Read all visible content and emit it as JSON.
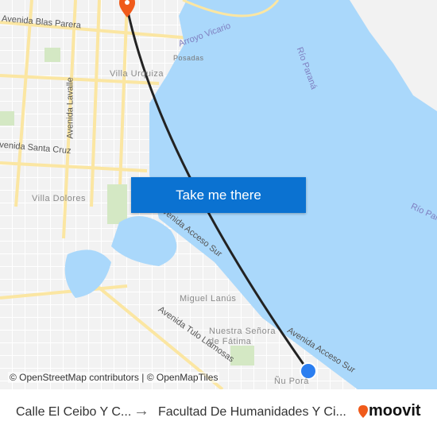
{
  "map": {
    "places": [
      "Villa Urquiza",
      "Posadas",
      "Villa Dolores",
      "Miguel Lanús",
      "Nuestra Señora de Fátima",
      "Ñu Porá"
    ],
    "roads": [
      "Avenida Blas Parera",
      "Avenida Lavalle",
      "Avenida Santa Cruz",
      "Avenida Acceso Sur",
      "Avenida Acceso Sur",
      "Avenida Tulo Llamosas"
    ],
    "water": [
      "Arroyo Vicario",
      "Río Paraná",
      "Río Paraná"
    ],
    "colors": {
      "water": "#aad8fb",
      "land": "#f2f2f2",
      "road": "#fbe6a2",
      "park": "#d4e8c4",
      "route": "#222222",
      "origin": "#2b7ef0",
      "destination_pin": "#f05a1a"
    },
    "icons": [
      "destination-pin-icon",
      "origin-dot-icon"
    ]
  },
  "cta": {
    "label": "Take me there"
  },
  "attribution": "© OpenStreetMap contributors | © OpenMapTiles",
  "footer": {
    "from": "Calle El Ceibo Y C...",
    "arrow": "→",
    "to": "Facultad De Humanidades Y Ci...",
    "brand": "moovit",
    "brand_color": "#f05a1a"
  }
}
